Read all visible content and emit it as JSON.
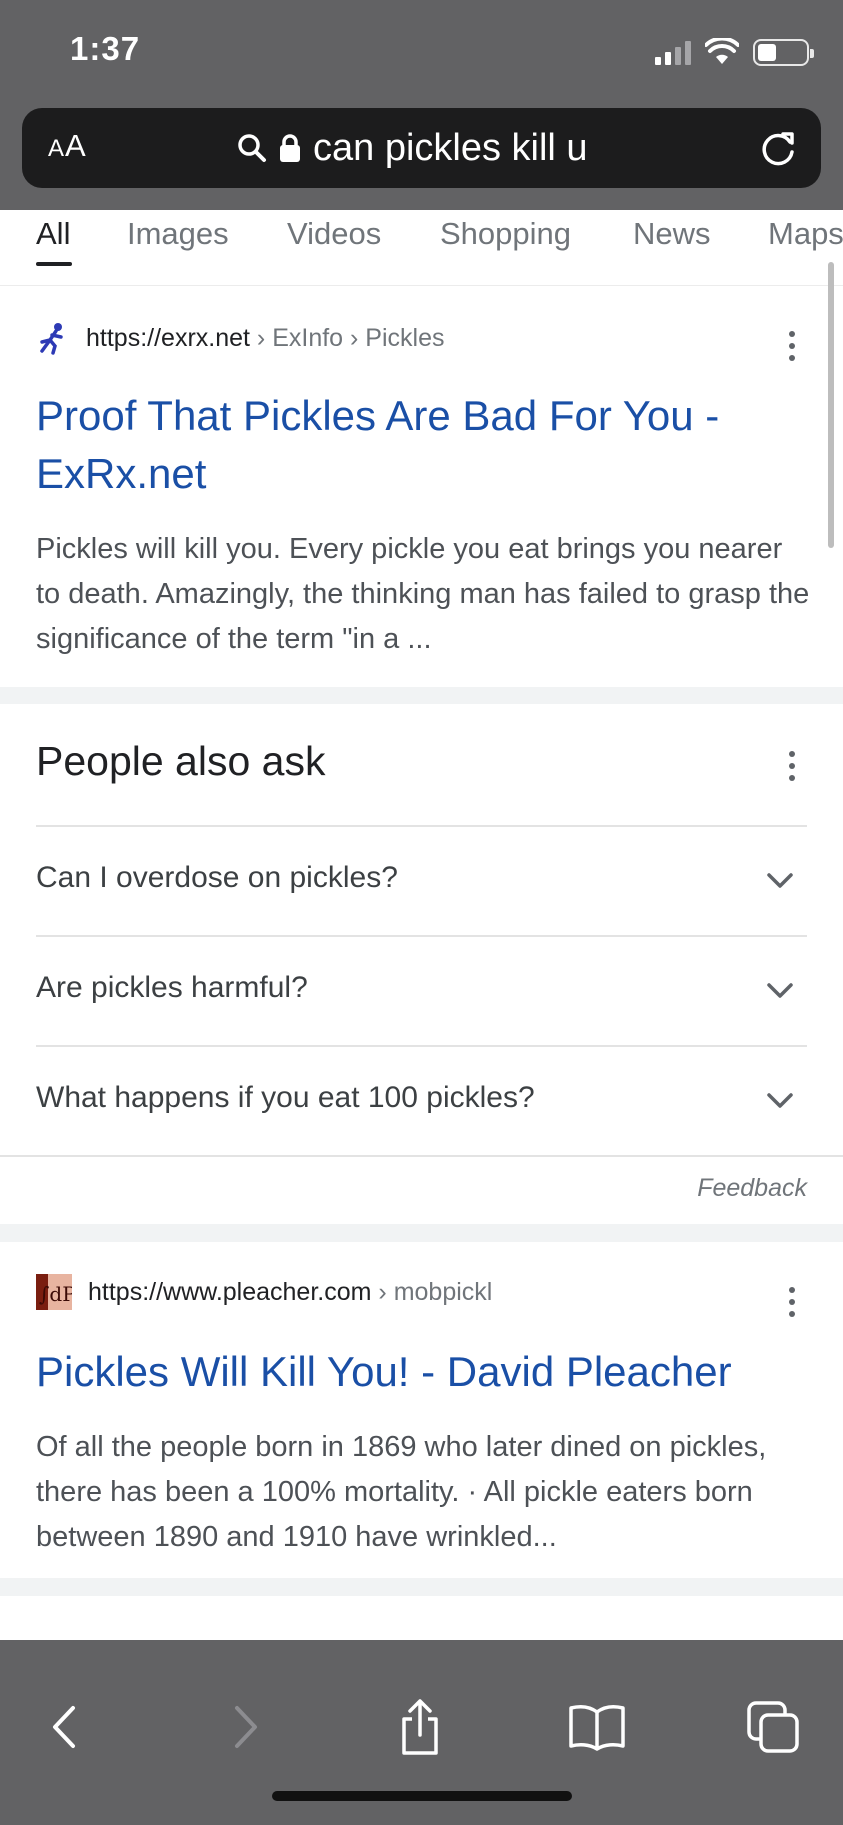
{
  "status_bar": {
    "time": "1:37"
  },
  "address_bar": {
    "aa_label_small": "A",
    "aa_label_large": "A",
    "query": "can pickles kill u"
  },
  "tabs": [
    "All",
    "Images",
    "Videos",
    "Shopping",
    "News",
    "Maps"
  ],
  "results": [
    {
      "site": "https://exrx.net",
      "breadcrumb": "› ExInfo › Pickles",
      "title": "Proof That Pickles Are Bad For You - ExRx.net",
      "snippet": "Pickles will kill you. Every pickle you eat brings you nearer to death. Amazingly, the thinking man has failed to grasp the significance of the term \"in a ..."
    },
    {
      "site": "https://www.pleacher.com",
      "breadcrumb": "› mobpickl",
      "title": "Pickles Will Kill You! - David Pleacher",
      "snippet": "Of all the people born in 1869 who later dined on pickles, there has been a 100% mortality. · All pickle eaters born between 1890 and 1910 have wrinkled..."
    }
  ],
  "people_also_ask": {
    "title": "People also ask",
    "questions": [
      "Can I overdose on pickles?",
      "Are pickles harmful?",
      "What happens if you eat 100 pickles?"
    ],
    "feedback": "Feedback"
  },
  "toolbar": {
    "icons": [
      "back-icon",
      "forward-icon",
      "share-icon",
      "bookmarks-icon",
      "tabs-icon"
    ]
  },
  "colors": {
    "chrome": "#626264",
    "url_bar": "#1c1c1d",
    "link_blue": "#1a4fa6"
  }
}
